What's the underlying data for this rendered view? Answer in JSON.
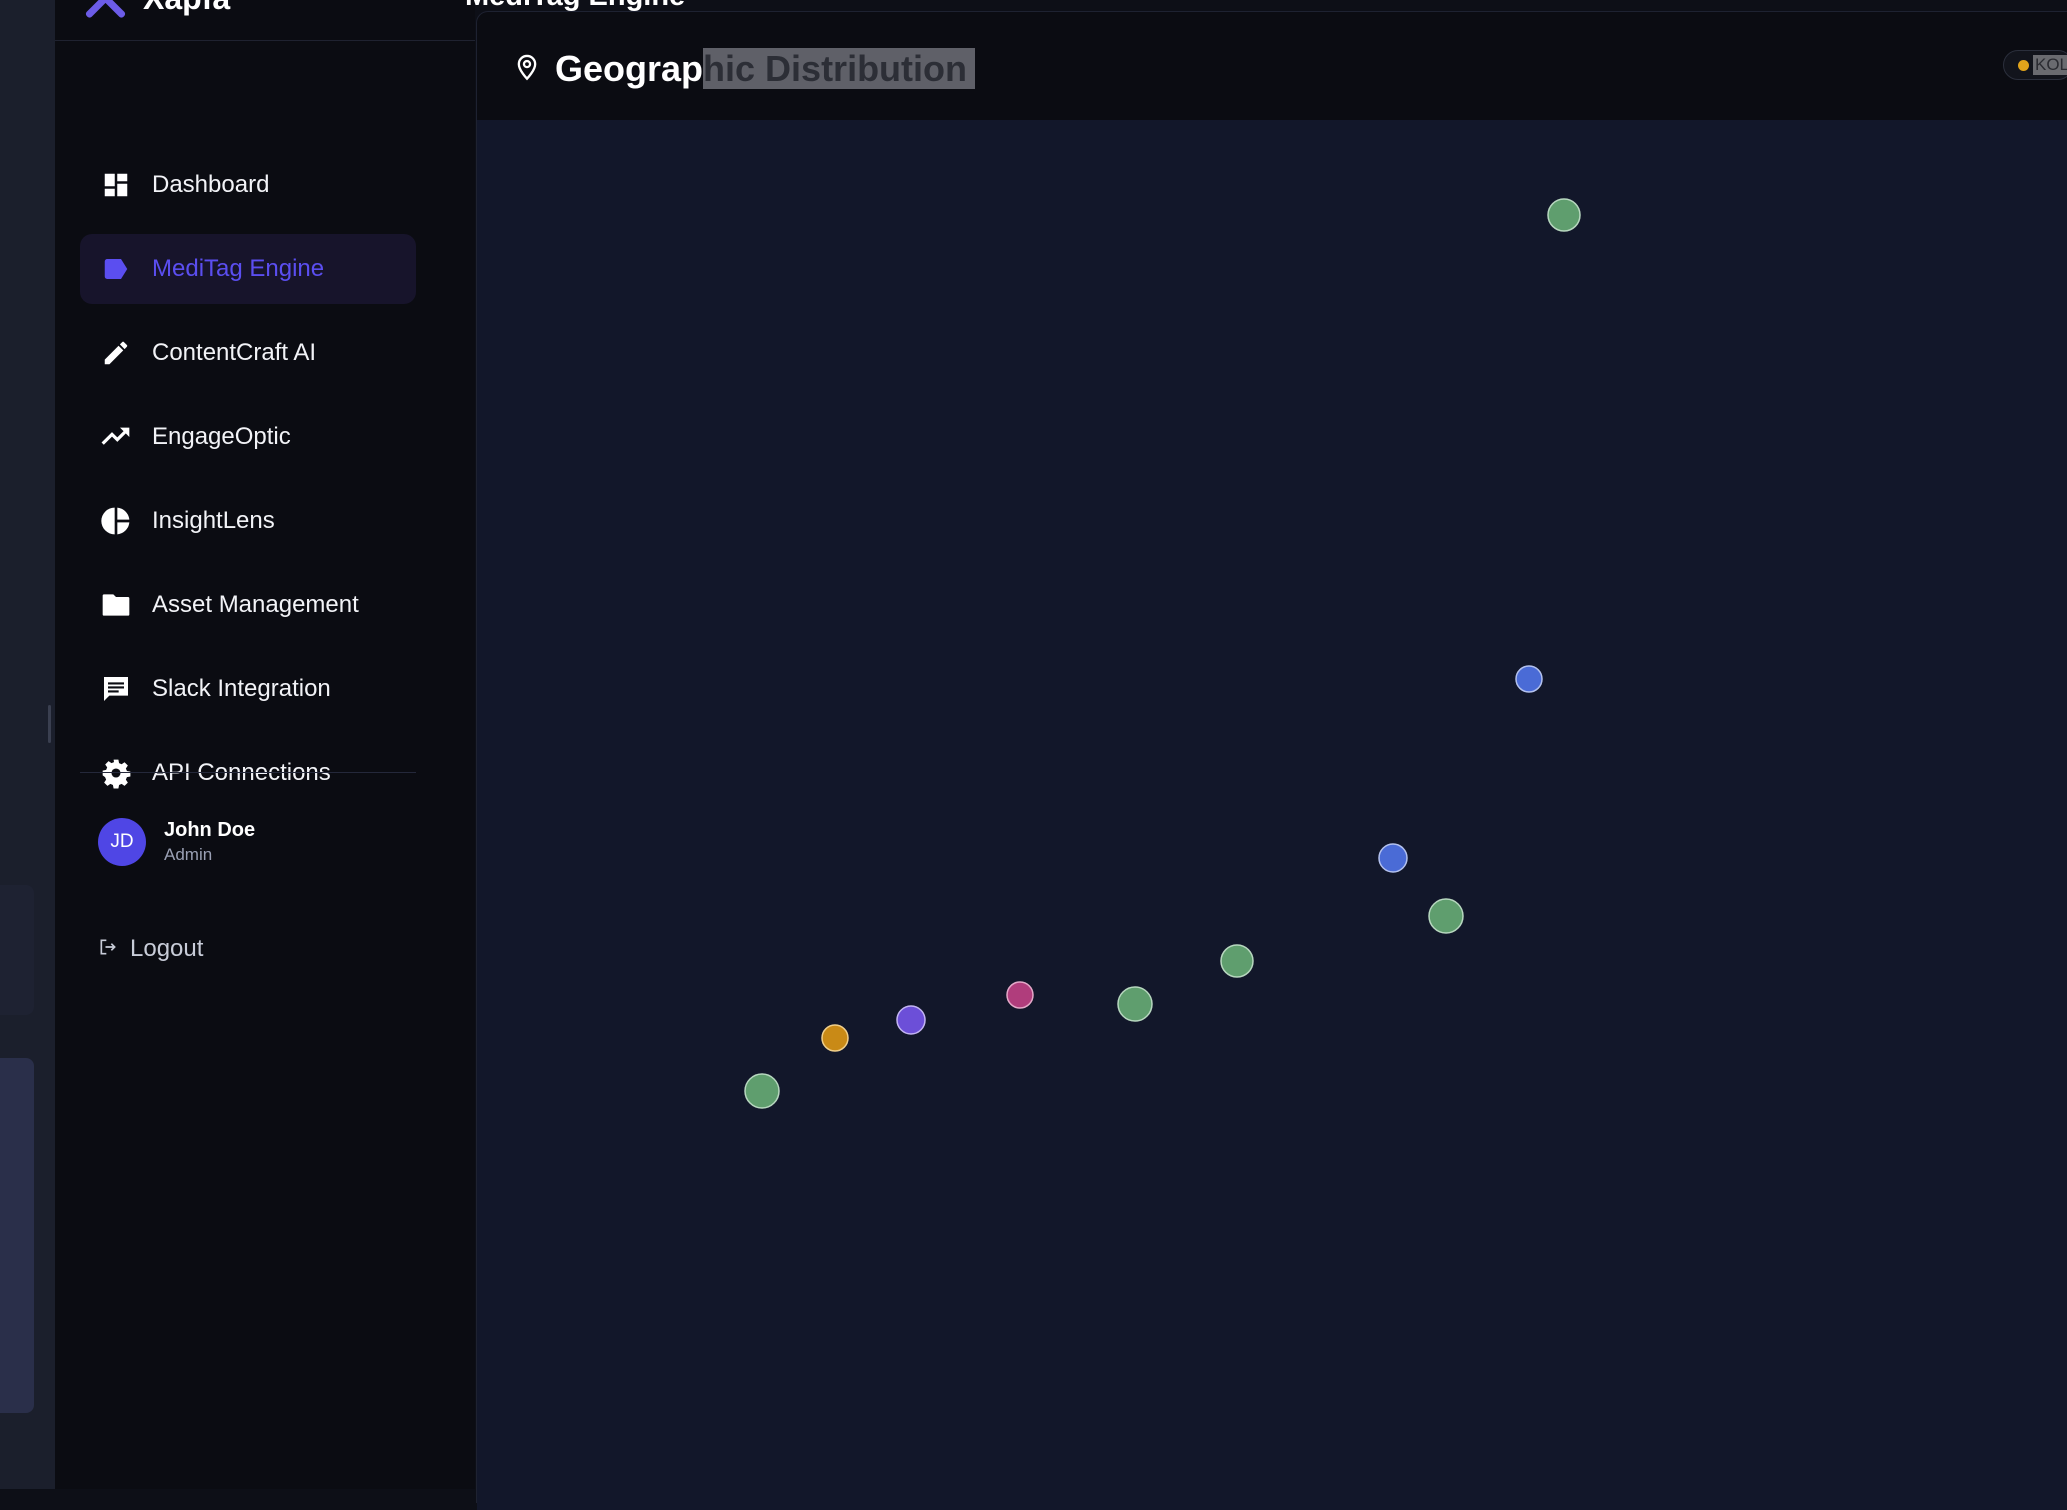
{
  "app": {
    "brand": "Xapfa",
    "page_title": "MediTag Engine"
  },
  "sidebar": {
    "items": [
      {
        "label": "Dashboard",
        "icon": "dashboard-icon",
        "active": false
      },
      {
        "label": "MediTag Engine",
        "icon": "tag-icon",
        "active": true
      },
      {
        "label": "ContentCraft AI",
        "icon": "pencil-icon",
        "active": false
      },
      {
        "label": "EngageOptic",
        "icon": "trending-up-icon",
        "active": false
      },
      {
        "label": "InsightLens",
        "icon": "pie-chart-icon",
        "active": false
      },
      {
        "label": "Asset Management",
        "icon": "folder-icon",
        "active": false
      },
      {
        "label": "Slack Integration",
        "icon": "chat-icon",
        "active": false
      },
      {
        "label": "API Connections",
        "icon": "gear-icon",
        "active": false
      }
    ],
    "user": {
      "initials": "JD",
      "name": "John Doe",
      "role": "Admin"
    },
    "logout_label": "Logout"
  },
  "card": {
    "title_plain": "Geograp",
    "title_selected": "hic Distribution",
    "legend_label": "KOL"
  },
  "colors": {
    "accent": "#5b4ef0",
    "green": "#5f9e6e",
    "blue": "#4a6bd6",
    "purple": "#6c4fd8",
    "pink": "#b03d7c",
    "amber": "#c98a16"
  }
}
